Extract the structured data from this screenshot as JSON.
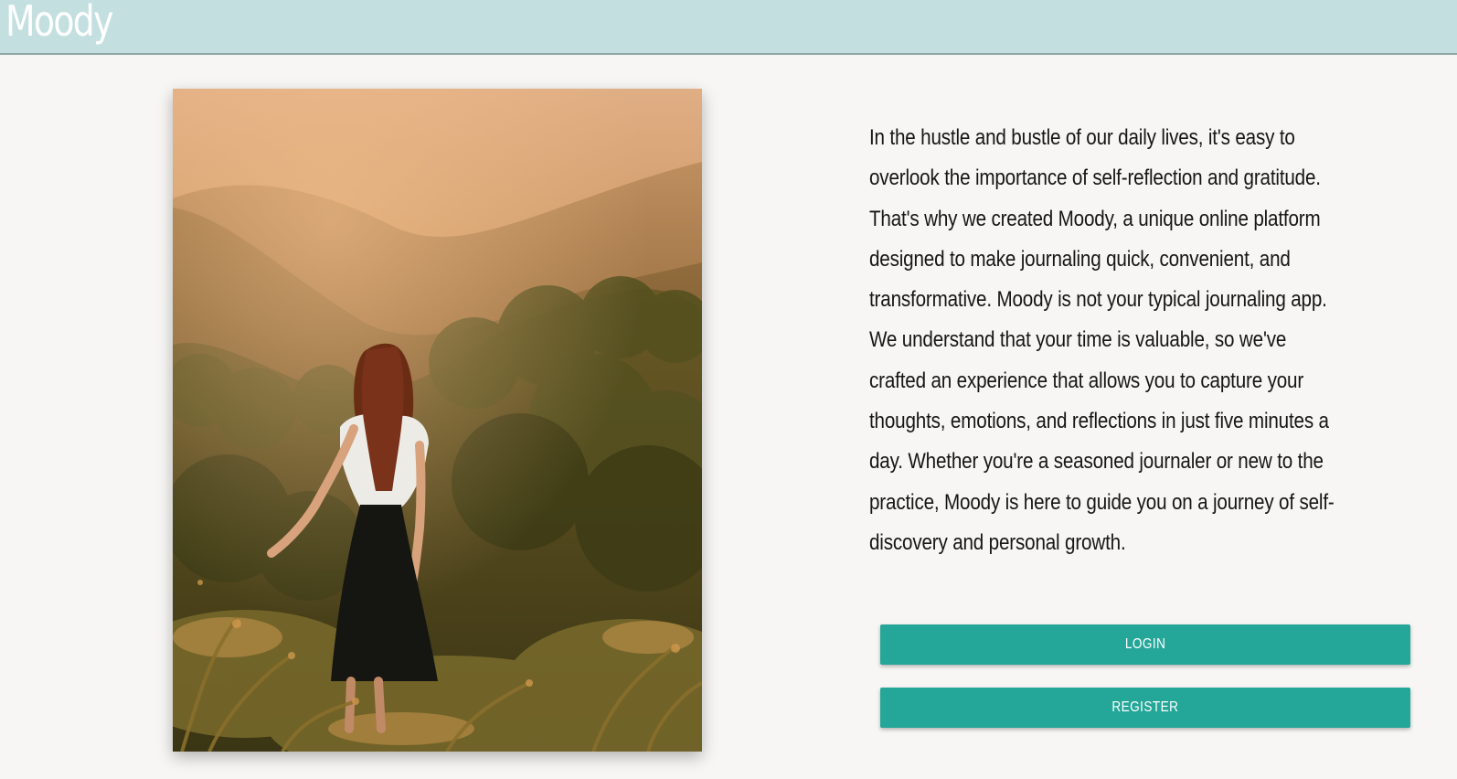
{
  "header": {
    "brand": "Moody"
  },
  "hero_image": {
    "description_icon": "hero-photo",
    "alt": "Woman walking through a hillside meadow at sunset"
  },
  "intro": {
    "text": "In the hustle and bustle of our daily lives, it's easy to overlook the importance of self-reflection and gratitude. That's why we created Moody, a unique online platform designed to make journaling quick, convenient, and transformative. Moody is not your typical journaling app. We understand that your time is valuable, so we've crafted an experience that allows you to capture your thoughts, emotions, and reflections in just five minutes a day. Whether you're a seasoned journaler or new to the practice, Moody is here to guide you on a journey of self-discovery and personal growth."
  },
  "actions": {
    "login_label": "LOGIN",
    "register_label": "REGISTER"
  },
  "colors": {
    "header_bg": "#c3dfe0",
    "page_bg": "#f7f6f4",
    "button_bg": "#24a698",
    "text": "#161616"
  }
}
